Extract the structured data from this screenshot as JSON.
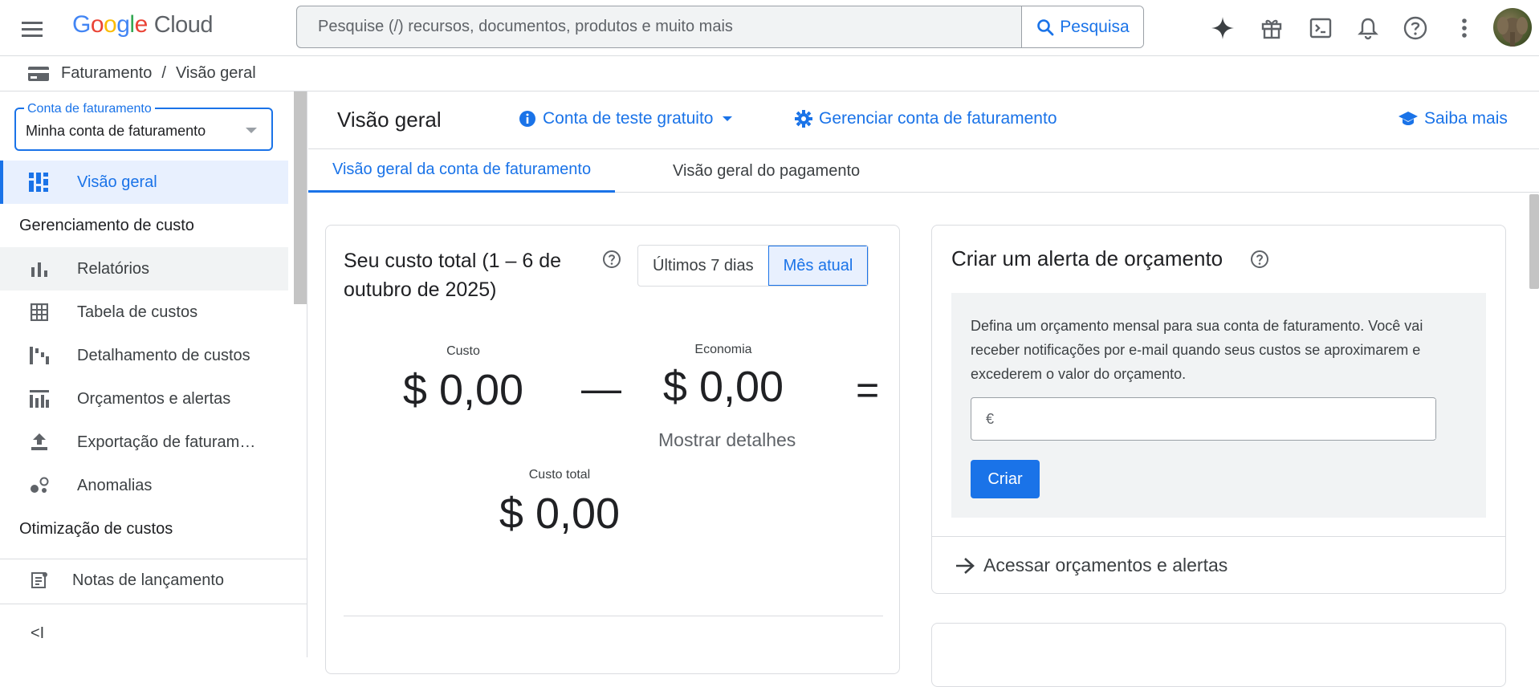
{
  "topbar": {
    "logo_google": "Google",
    "logo_cloud": "Cloud",
    "search_placeholder": "Pesquise (/) recursos, documentos, produtos e muito mais",
    "search_button": "Pesquisa",
    "icons": [
      "menu-icon",
      "gemini-icon",
      "gift-icon",
      "cloud-shell-icon",
      "notifications-icon",
      "help-icon",
      "more-vert-icon",
      "avatar"
    ]
  },
  "breadcrumb": {
    "items": [
      "Faturamento",
      "Visão geral"
    ],
    "separator": "/"
  },
  "sidebar": {
    "account_label": "Conta de faturamento",
    "account_value": "Minha conta de faturamento",
    "overview": "Visão geral",
    "section_cost_mgmt": "Gerenciamento de custo",
    "items": [
      {
        "label": "Relatórios",
        "icon": "bar-chart-icon"
      },
      {
        "label": "Tabela de custos",
        "icon": "table-icon"
      },
      {
        "label": "Detalhamento de custos",
        "icon": "waterfall-icon"
      },
      {
        "label": "Orçamentos e alertas",
        "icon": "budget-icon"
      },
      {
        "label": "Exportação de faturam…",
        "icon": "upload-icon"
      },
      {
        "label": "Anomalias",
        "icon": "anomaly-icon"
      }
    ],
    "section_optimization": "Otimização de custos",
    "release_notes": "Notas de lançamento",
    "collapse": "<I"
  },
  "header": {
    "title": "Visão geral",
    "trial_account": "Conta de teste gratuito",
    "manage_account": "Gerenciar conta de faturamento",
    "learn_more": "Saiba mais"
  },
  "tabs": [
    {
      "label": "Visão geral da conta de faturamento",
      "active": true
    },
    {
      "label": "Visão geral do pagamento",
      "active": false
    }
  ],
  "cost_card": {
    "title": "Seu custo total (1 – 6 de outubro de 2025)",
    "toggle_last7": "Últimos 7 dias",
    "toggle_current": "Mês atual",
    "cost_label": "Custo",
    "cost_value": "$ 0,00",
    "minus": "—",
    "savings_label": "Economia",
    "savings_value": "$ 0,00",
    "equals": "=",
    "show_details": "Mostrar detalhes",
    "total_label": "Custo total",
    "total_value": "$ 0,00"
  },
  "alert_card": {
    "title": "Criar um alerta de orçamento",
    "description": "Defina um orçamento mensal para sua conta de faturamento. Você vai receber notificações por e-mail quando seus custos se aproximarem e excederem o valor do orçamento.",
    "currency_prefix": "€",
    "input_value": "",
    "create_button": "Criar",
    "link": "Acessar orçamentos e alertas"
  },
  "colors": {
    "accent": "#1a73e8",
    "active_bg": "#e8f0fe",
    "border": "#dadce0",
    "text": "#202124"
  }
}
